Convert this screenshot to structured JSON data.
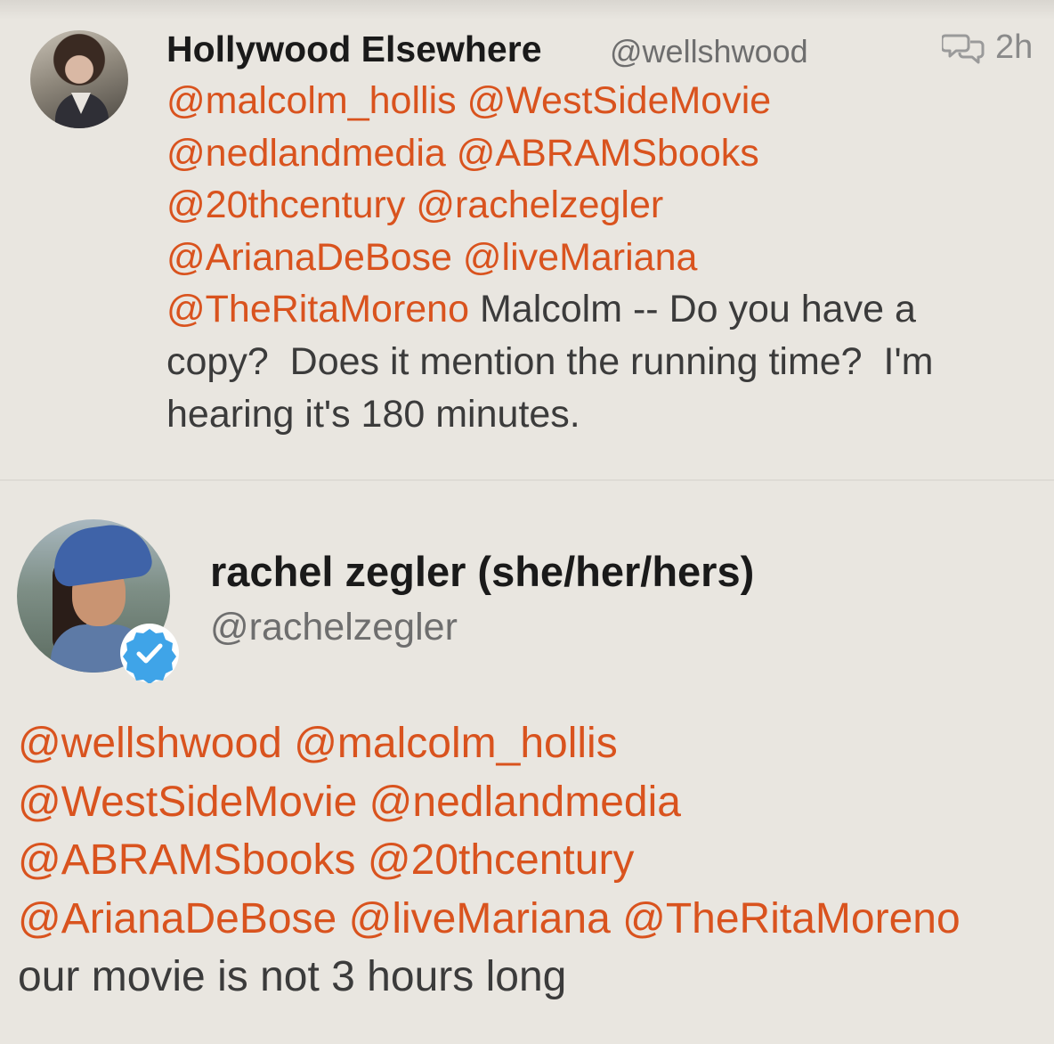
{
  "colors": {
    "background": "#e9e6e0",
    "mention": "#d9531e",
    "name": "#1a1a1a",
    "text": "#3b3b3b",
    "handle": "#6e6e6e",
    "verified": "#3fa4e8"
  },
  "tweet1": {
    "display_name": "Hollywood Elsewhere",
    "handle": "@wellshwood",
    "time": "2h",
    "reply_icon": "conversation-icon",
    "lines": [
      {
        "parts": [
          {
            "text": "@malcolm_hollis",
            "mention": true
          },
          {
            "text": " ",
            "mention": false
          },
          {
            "text": "@WestSideMovie",
            "mention": true
          }
        ]
      },
      {
        "parts": [
          {
            "text": "@nedlandmedia",
            "mention": true
          },
          {
            "text": " ",
            "mention": false
          },
          {
            "text": "@ABRAMSbooks",
            "mention": true
          }
        ]
      },
      {
        "parts": [
          {
            "text": "@20thcentury",
            "mention": true
          },
          {
            "text": " ",
            "mention": false
          },
          {
            "text": "@rachelzegler",
            "mention": true
          }
        ]
      },
      {
        "parts": [
          {
            "text": "@ArianaDeBose",
            "mention": true
          },
          {
            "text": " ",
            "mention": false
          },
          {
            "text": "@liveMariana",
            "mention": true
          }
        ]
      },
      {
        "parts": [
          {
            "text": "@TheRitaMoreno",
            "mention": true
          },
          {
            "text": " Malcolm -- Do you have a",
            "mention": false
          }
        ]
      },
      {
        "parts": [
          {
            "text": "copy?  Does it mention the running time?  I'm",
            "mention": false
          }
        ]
      },
      {
        "parts": [
          {
            "text": "hearing it's 180 minutes.",
            "mention": false
          }
        ]
      }
    ]
  },
  "tweet2": {
    "display_name": "rachel zegler (she/her/hers)",
    "handle": "@rachelzegler",
    "verified_icon": "verified-badge-icon",
    "lines": [
      {
        "parts": [
          {
            "text": "@wellshwood",
            "mention": true
          },
          {
            "text": " ",
            "mention": false
          },
          {
            "text": "@malcolm_hollis",
            "mention": true
          }
        ]
      },
      {
        "parts": [
          {
            "text": "@WestSideMovie",
            "mention": true
          },
          {
            "text": " ",
            "mention": false
          },
          {
            "text": "@nedlandmedia",
            "mention": true
          }
        ]
      },
      {
        "parts": [
          {
            "text": "@ABRAMSbooks",
            "mention": true
          },
          {
            "text": " ",
            "mention": false
          },
          {
            "text": "@20thcentury",
            "mention": true
          }
        ]
      },
      {
        "parts": [
          {
            "text": "@ArianaDeBose",
            "mention": true
          },
          {
            "text": " ",
            "mention": false
          },
          {
            "text": "@liveMariana",
            "mention": true
          },
          {
            "text": " ",
            "mention": false
          },
          {
            "text": "@TheRitaMoreno",
            "mention": true
          }
        ]
      },
      {
        "parts": [
          {
            "text": "our movie is not 3 hours long",
            "mention": false
          }
        ]
      }
    ]
  }
}
